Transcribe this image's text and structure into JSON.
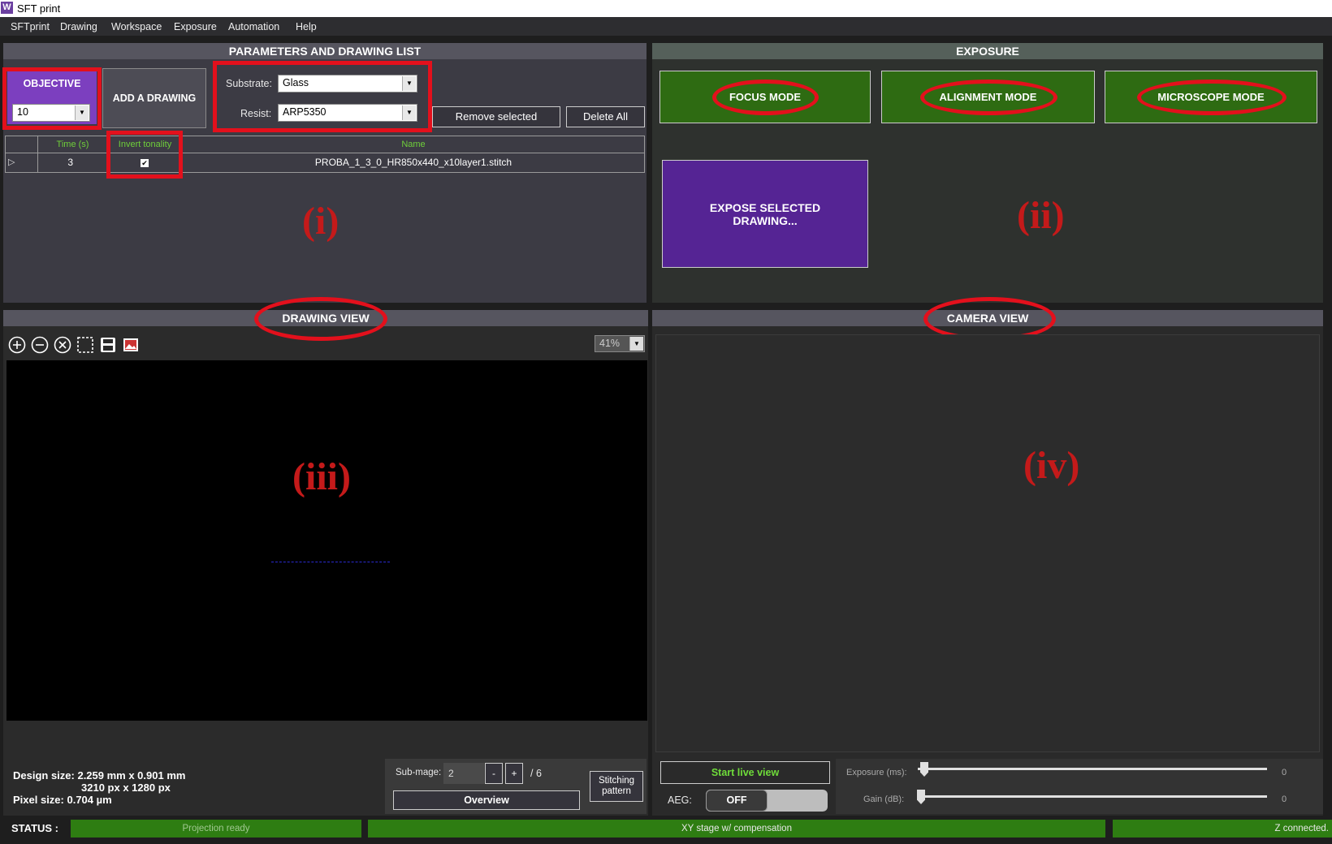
{
  "window": {
    "title": "SFT print",
    "logo_text": "W"
  },
  "menu": [
    "SFTprint",
    "Drawing",
    "Workspace",
    "Exposure",
    "Automation",
    "Help"
  ],
  "params": {
    "header": "PARAMETERS AND DRAWING LIST",
    "objective_label": "OBJECTIVE",
    "objective_value": "10",
    "add_drawing": "ADD A DRAWING",
    "substrate_label": "Substrate:",
    "substrate_value": "Glass",
    "resist_label": "Resist:",
    "resist_value": "ARP5350",
    "remove_selected": "Remove selected",
    "delete_all": "Delete All",
    "columns": [
      "Time (s)",
      "Invert tonality",
      "Name"
    ],
    "row": {
      "time": "3",
      "invert": "✔",
      "name": "PROBA_1_3_0_HR850x440_x10layer1.stitch"
    },
    "marker": "(i)"
  },
  "exposure": {
    "header": "EXPOSURE",
    "focus": "FOCUS MODE",
    "alignment": "ALIGNMENT MODE",
    "microscope": "MICROSCOPE MODE",
    "expose": "EXPOSE SELECTED DRAWING...",
    "marker": "(ii)"
  },
  "drawing_view": {
    "header": "DRAWING VIEW",
    "zoom": "41%",
    "marker": "(iii)",
    "design_size_line1": "Design size: 2.259 mm x 0.901 mm",
    "design_size_line2": "3210 px x 1280 px",
    "pixel_size": "Pixel size: 0.704 µm",
    "subimage_label": "Sub-mage:",
    "subimage_value": "2",
    "minus": "-",
    "plus": "+",
    "of_total": "/ 6",
    "overview": "Overview",
    "stitching_pattern": "Stitching pattern"
  },
  "camera_view": {
    "header": "CAMERA VIEW",
    "marker": "(iv)",
    "start_live": "Start live view",
    "aeg_label": "AEG:",
    "aeg_state": "OFF",
    "exposure_label": "Exposure (ms):",
    "exposure_value": "0",
    "gain_label": "Gain (dB):",
    "gain_value": "0"
  },
  "status": {
    "label": "STATUS :",
    "projection": "Projection ready",
    "xy": "XY stage w/ compensation",
    "z": "Z connected."
  },
  "colors": {
    "accent_red": "#e3101c",
    "green": "#2e6b12",
    "purple": "#7c3fbf"
  }
}
